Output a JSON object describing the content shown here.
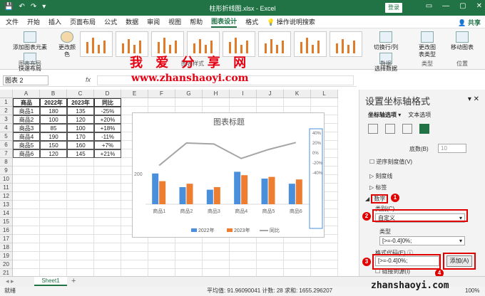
{
  "titlebar": {
    "title": "柱形折线图.xlsx - Excel",
    "login": "登录",
    "qa": [
      "💾",
      "↶",
      "↷",
      "▾"
    ],
    "win": [
      "▭",
      "—",
      "▢",
      "✕"
    ]
  },
  "menu": {
    "items": [
      "文件",
      "开始",
      "插入",
      "页面布局",
      "公式",
      "数据",
      "审阅",
      "视图",
      "帮助",
      "图表设计",
      "格式"
    ],
    "active": "图表设计",
    "tell": "操作说明搜索",
    "share": "共享"
  },
  "ribbon": {
    "g1": {
      "b1": "添加图表元素",
      "b2": "快速布局",
      "label": "图表布局"
    },
    "g2": {
      "b1": "更改颜色"
    },
    "styles_label": "图表样式",
    "g3": {
      "b1": "切换行/列",
      "b2": "选择数据",
      "label": "数据"
    },
    "g4": {
      "b1": "更改图表类型",
      "label": "类型"
    },
    "g5": {
      "b1": "移动图表",
      "label": "位置"
    }
  },
  "watermark": {
    "cn": "我 爱 分 享 网",
    "url": "www.zhanshaoyi.com",
    "bottom": "zhanshaoyi.com"
  },
  "formula": {
    "namebox": "图表 2",
    "fx": "fx"
  },
  "grid": {
    "cols": [
      "A",
      "B",
      "C",
      "D",
      "E",
      "F",
      "G",
      "H",
      "I",
      "J",
      "K",
      "L"
    ],
    "rows": [
      "1",
      "2",
      "3",
      "4",
      "5",
      "6",
      "7",
      "8",
      "9",
      "10",
      "11",
      "12",
      "13",
      "14",
      "15",
      "16",
      "17",
      "18",
      "19",
      "20",
      "21"
    ],
    "table": {
      "header": [
        "商品",
        "2022年",
        "2023年",
        "同比"
      ],
      "data": [
        [
          "商品1",
          "180",
          "135",
          "-25%"
        ],
        [
          "商品2",
          "100",
          "120",
          "+20%"
        ],
        [
          "商品3",
          "85",
          "100",
          "+18%"
        ],
        [
          "商品4",
          "190",
          "170",
          "-11%"
        ],
        [
          "商品5",
          "150",
          "160",
          "+7%"
        ],
        [
          "商品6",
          "120",
          "145",
          "+21%"
        ]
      ]
    }
  },
  "chart_data": {
    "type": "bar",
    "title": "图表标题",
    "categories": [
      "商品1",
      "商品2",
      "商品3",
      "商品4",
      "商品5",
      "商品6"
    ],
    "series": [
      {
        "name": "2022年",
        "values": [
          180,
          100,
          85,
          190,
          150,
          120
        ],
        "color": "#4a8fdc"
      },
      {
        "name": "2023年",
        "values": [
          135,
          120,
          100,
          170,
          160,
          145
        ],
        "color": "#ed7d31"
      },
      {
        "name": "同比",
        "type": "line",
        "values": [
          -25,
          20,
          18,
          -11,
          7,
          21
        ],
        "color": "#a5a5a5",
        "axis": "secondary"
      }
    ],
    "ylim": [
      0,
      200
    ],
    "y2lim": [
      -40,
      40
    ],
    "y2ticks": [
      "40%",
      "20%",
      "0%",
      "-20%",
      "-40%"
    ],
    "yticks": [
      "200"
    ]
  },
  "sheet": {
    "tab": "Sheet1",
    "add": "+"
  },
  "status": {
    "left": "就绪",
    "right": "平均值: 91.96090041    计数: 28    求和: 1655.296207",
    "zoom": "100%"
  },
  "pane": {
    "title": "设置坐标轴格式",
    "tab1": "坐标轴选项",
    "tab2": "文本选项",
    "r_base": "底数(B)",
    "r_base_val": "10",
    "r_reverse": "逆序刻度值(V)",
    "r_tick": "刻度线",
    "r_label": "标签",
    "r_number": "数字",
    "r_cat": "类别(C)",
    "r_cat_val": "自定义",
    "r_type": "类型",
    "r_type_val": "[>=-0.4]0%;",
    "r_code": "格式代码(E)",
    "r_code_val": "[>=-0.4]0%;",
    "r_add": "添加(A)",
    "r_link": "链接到源(I)"
  },
  "badges": [
    "1",
    "2",
    "3",
    "4"
  ]
}
